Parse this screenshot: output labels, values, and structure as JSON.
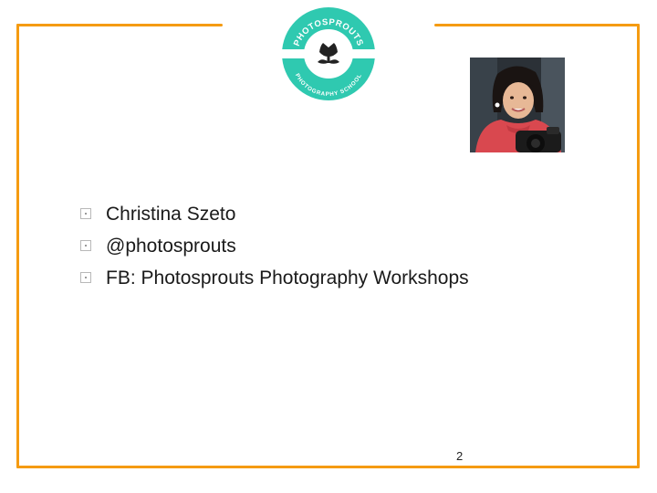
{
  "slide": {
    "logo": {
      "icon": "photosprouts-logo-icon",
      "arc_top_text": "PHOTOSPROUTS",
      "arc_bottom_text": "PHOTOGRAPHY SCHOOL",
      "ring_color": "#2fc9b0"
    },
    "photo": {
      "icon": "portrait-photo"
    },
    "bullets": [
      {
        "text": "Christina Szeto"
      },
      {
        "text": "@photosprouts"
      },
      {
        "text": "FB: Photosprouts Photography Workshops"
      }
    ],
    "page_number": "2",
    "frame_color": "#f59b12"
  }
}
